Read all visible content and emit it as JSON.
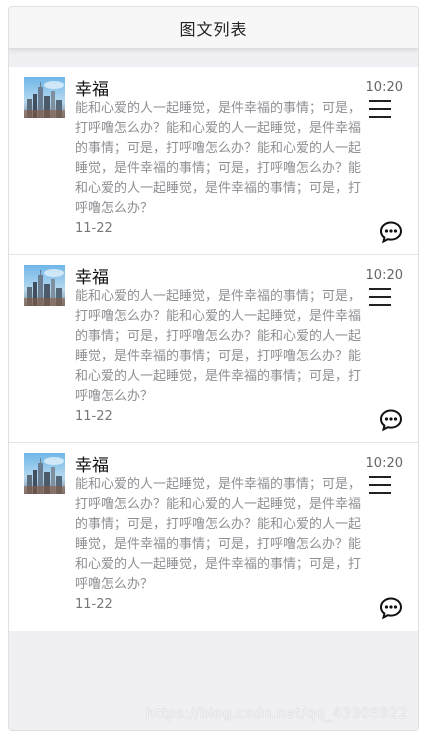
{
  "header": {
    "title": "图文列表"
  },
  "items": [
    {
      "title": "幸福",
      "time": "10:20",
      "description": "能和心爱的人一起睡觉，是件幸福的事情；可是，打呼噜怎么办？能和心爱的人一起睡觉，是件幸福的事情；可是，打呼噜怎么办？能和心爱的人一起睡觉，是件幸福的事情；可是，打呼噜怎么办？能和心爱的人一起睡觉，是件幸福的事情；可是，打呼噜怎么办？",
      "date": "11-22",
      "thumbnail_icon": "city-skyline-image",
      "menu_icon": "hamburger-menu-icon",
      "comment_icon": "chat-bubble-icon"
    },
    {
      "title": "幸福",
      "time": "10:20",
      "description": "能和心爱的人一起睡觉，是件幸福的事情；可是，打呼噜怎么办？能和心爱的人一起睡觉，是件幸福的事情；可是，打呼噜怎么办？能和心爱的人一起睡觉，是件幸福的事情；可是，打呼噜怎么办？能和心爱的人一起睡觉，是件幸福的事情；可是，打呼噜怎么办？",
      "date": "11-22",
      "thumbnail_icon": "city-skyline-image",
      "menu_icon": "hamburger-menu-icon",
      "comment_icon": "chat-bubble-icon"
    },
    {
      "title": "幸福",
      "time": "10:20",
      "description": "能和心爱的人一起睡觉，是件幸福的事情；可是，打呼噜怎么办？能和心爱的人一起睡觉，是件幸福的事情；可是，打呼噜怎么办？能和心爱的人一起睡觉，是件幸福的事情；可是，打呼噜怎么办？能和心爱的人一起睡觉，是件幸福的事情；可是，打呼噜怎么办？",
      "date": "11-22",
      "thumbnail_icon": "city-skyline-image",
      "menu_icon": "hamburger-menu-icon",
      "comment_icon": "chat-bubble-icon"
    }
  ],
  "watermark": "https://blog.csdn.net/qq_43305922"
}
